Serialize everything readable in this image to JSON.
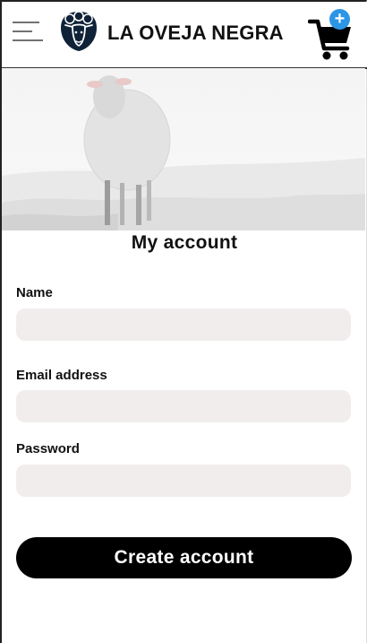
{
  "header": {
    "brand_name": "LA OVEJA NEGRA",
    "cart_badge": "+",
    "menu_icon": "hamburger-icon",
    "logo_icon": "sheep-logo-icon",
    "cart_icon": "shopping-cart-icon"
  },
  "hero": {
    "image": "white-sheep-photo"
  },
  "form": {
    "title": "My account",
    "name_label": "Name",
    "name_value": "",
    "email_label": "Email address",
    "email_value": "",
    "password_label": "Password",
    "password_value": "",
    "submit_label": "Create account"
  },
  "colors": {
    "badge": "#2b95e6",
    "field_background": "#f1eded",
    "button_background": "#000000",
    "logo": "#0f2238"
  }
}
